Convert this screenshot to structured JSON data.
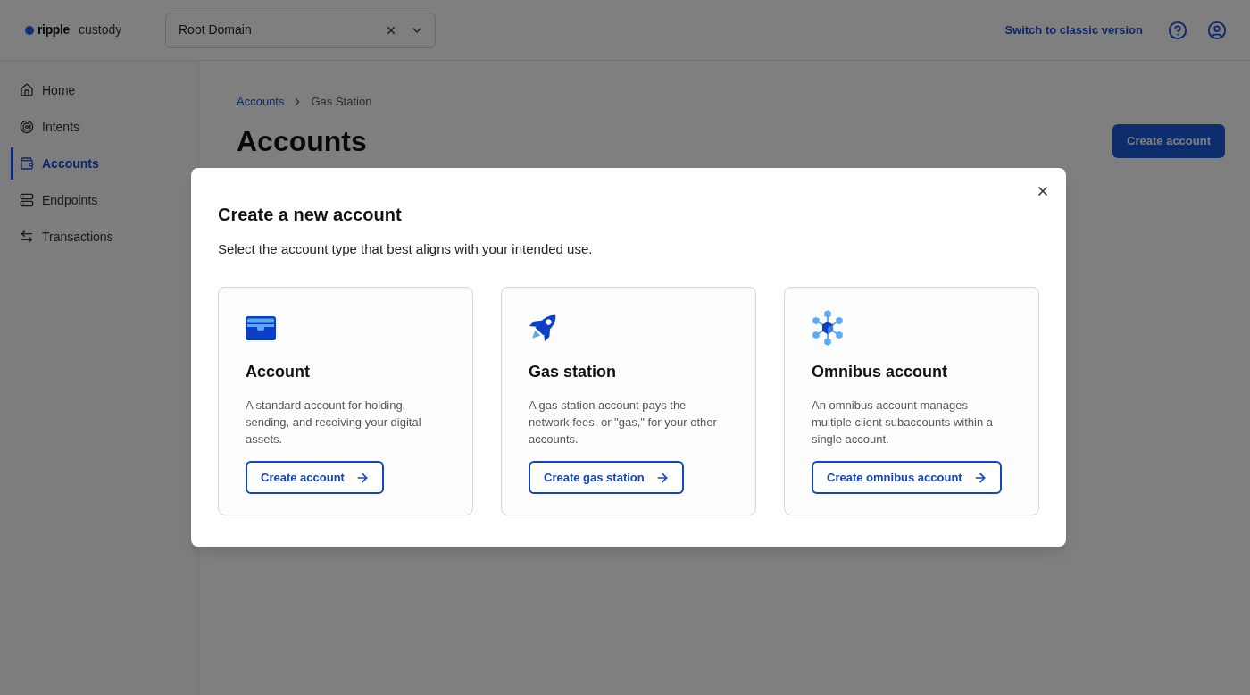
{
  "header": {
    "logo": {
      "brand": "ripple",
      "product": "custody"
    },
    "domain_select": {
      "value": "Root Domain"
    },
    "switch_link": "Switch to classic version"
  },
  "sidebar": {
    "items": [
      {
        "kind": "home",
        "label": "Home",
        "selected": false
      },
      {
        "kind": "intents",
        "label": "Intents",
        "selected": false
      },
      {
        "kind": "accounts",
        "label": "Accounts",
        "selected": true
      },
      {
        "kind": "endpoints",
        "label": "Endpoints",
        "selected": false
      },
      {
        "kind": "transactions",
        "label": "Transactions",
        "selected": false
      }
    ]
  },
  "page": {
    "breadcrumb": {
      "link": "Accounts",
      "current": "Gas Station"
    },
    "title": "Accounts",
    "primary_button": "Create account"
  },
  "modal": {
    "title": "Create a new account",
    "subtitle": "Select the account type that best aligns with your intended use.",
    "options": [
      {
        "kind": "account",
        "title": "Account",
        "description": "A standard account for holding, sending, and receiving your digital assets.",
        "button": "Create account"
      },
      {
        "kind": "gas_station",
        "title": "Gas station",
        "description": "A gas station account pays the network fees, or \"gas,\" for your other accounts.",
        "button": "Create gas station"
      },
      {
        "kind": "omnibus",
        "title": "Omnibus account",
        "description": "An omnibus account manages multiple client subaccounts within a single account.",
        "button": "Create omnibus account"
      }
    ]
  }
}
